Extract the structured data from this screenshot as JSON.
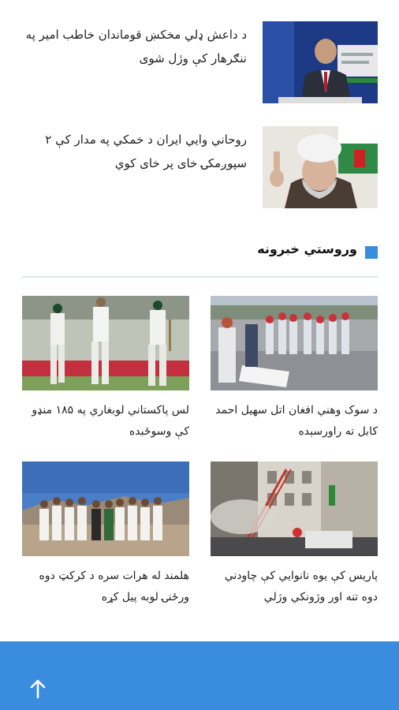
{
  "top_stories": [
    {
      "title": "د داعش ډلي مخکښ قوماندان خاطب امیر په ننګرهار کې وژل شوی",
      "thumb_icon": "speaker-at-podium-photo"
    },
    {
      "title": "روحاني وايي ایران د خمکي په مدار کې ۲ سپوږمکۍ خای پر خای کوي",
      "thumb_icon": "cleric-portrait-photo"
    }
  ],
  "section": {
    "title": "وروستي خبرونه",
    "accent_color": "#3a8dde"
  },
  "grid": [
    {
      "caption": "لس پاکستاني لوبغاري په ۱۸۵ منډو کې وسوځبده",
      "image_icon": "cricket-players-photo"
    },
    {
      "caption": "د سوک وهني افغان اتل سهیل احمد کابل ته راورسېده",
      "image_icon": "ceremony-children-photo"
    },
    {
      "caption": "هلمند له هرات سره د کرکټ دوه ورځنۍ لوبه پیل کړه",
      "image_icon": "team-group-photo"
    },
    {
      "caption": "پاریس کې یوه نانوایي کې چاودني دوه تنه اور وژونکي وژلي",
      "image_icon": "paris-fire-street-photo"
    }
  ],
  "footer": {
    "color": "#3a8dde",
    "icon": "arrow-up-icon"
  }
}
